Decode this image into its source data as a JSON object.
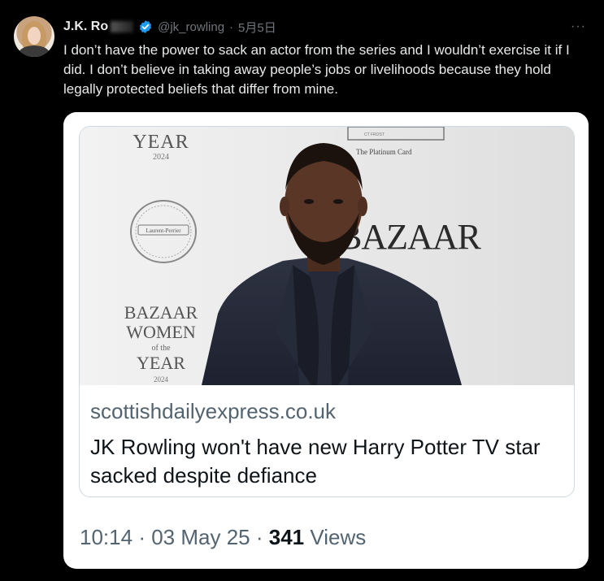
{
  "tweet": {
    "display_name": "J.K. Ro",
    "handle": "@jk_rowling",
    "separator": "·",
    "date": "5月5日",
    "more": "···",
    "text": "I don’t have the power to sack an actor from the series and I wouldn’t exercise it if I did. I don’t believe in taking away people’s jobs or livelihoods because they hold legally protected beliefs that differ from mine."
  },
  "card": {
    "image": {
      "backdrop_top": "YEAR",
      "backdrop_top_year": "2024",
      "seal_line1": "Laurent-Perrier",
      "sponsor": "The Platinum Card",
      "sponsor_small": "CT FROST",
      "magazine": "BAZAAR",
      "backdrop_left_1": "BAZAAR",
      "backdrop_left_2": "WOMEN",
      "backdrop_left_3": "of the",
      "backdrop_left_4": "YEAR",
      "backdrop_left_5": "2024"
    },
    "domain": "scottishdailyexpress.co.uk",
    "headline": "JK Rowling won't have new Harry Potter TV star sacked despite defiance",
    "time": "10:14",
    "sep1": "·",
    "date": "03 May 25",
    "sep2": "·",
    "views_count": "341",
    "views_label": "Views"
  },
  "colors": {
    "background": "#000000",
    "text_primary_dark": "#e7e9ea",
    "text_secondary": "#71767b",
    "verified_blue": "#1d9bf0",
    "card_bg": "#ffffff",
    "card_text": "#0f1419",
    "card_muted": "#536471"
  },
  "icons": {
    "verified": "verified-badge-icon",
    "more": "more-options-icon"
  }
}
